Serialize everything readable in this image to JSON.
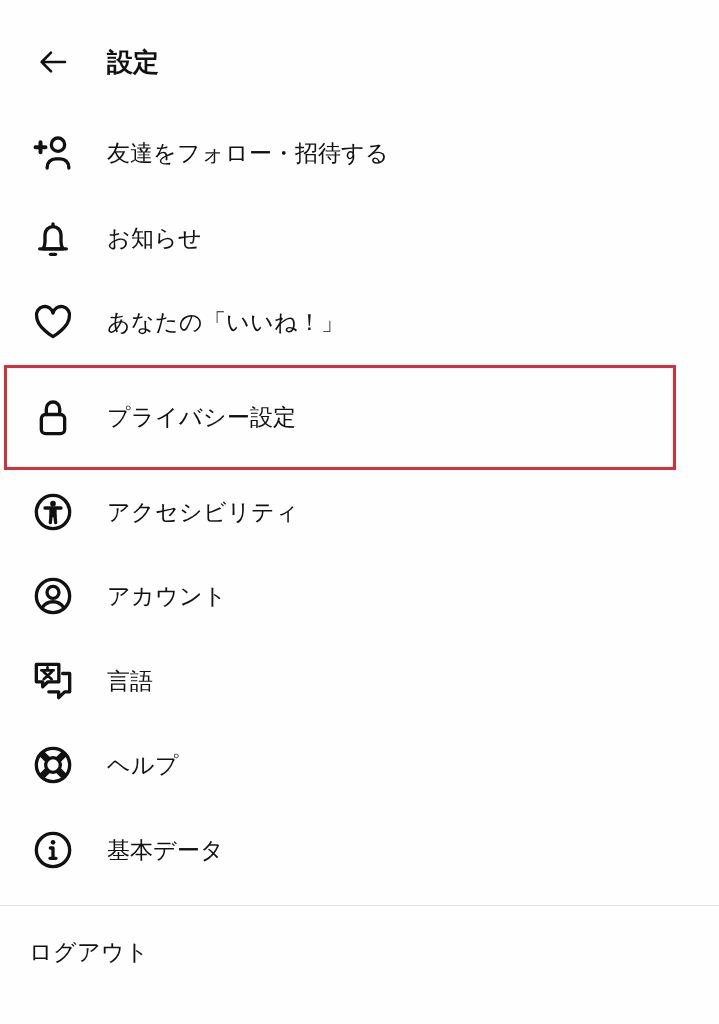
{
  "header": {
    "title": "設定"
  },
  "menu": {
    "items": [
      {
        "label": "友達をフォロー・招待する",
        "highlighted": false
      },
      {
        "label": "お知らせ",
        "highlighted": false
      },
      {
        "label": "あなたの「いいね！」",
        "highlighted": false
      },
      {
        "label": "プライバシー設定",
        "highlighted": true
      },
      {
        "label": "アクセシビリティ",
        "highlighted": false
      },
      {
        "label": "アカウント",
        "highlighted": false
      },
      {
        "label": "言語",
        "highlighted": false
      },
      {
        "label": "ヘルプ",
        "highlighted": false
      },
      {
        "label": "基本データ",
        "highlighted": false
      }
    ]
  },
  "footer": {
    "logout": "ログアウト"
  }
}
